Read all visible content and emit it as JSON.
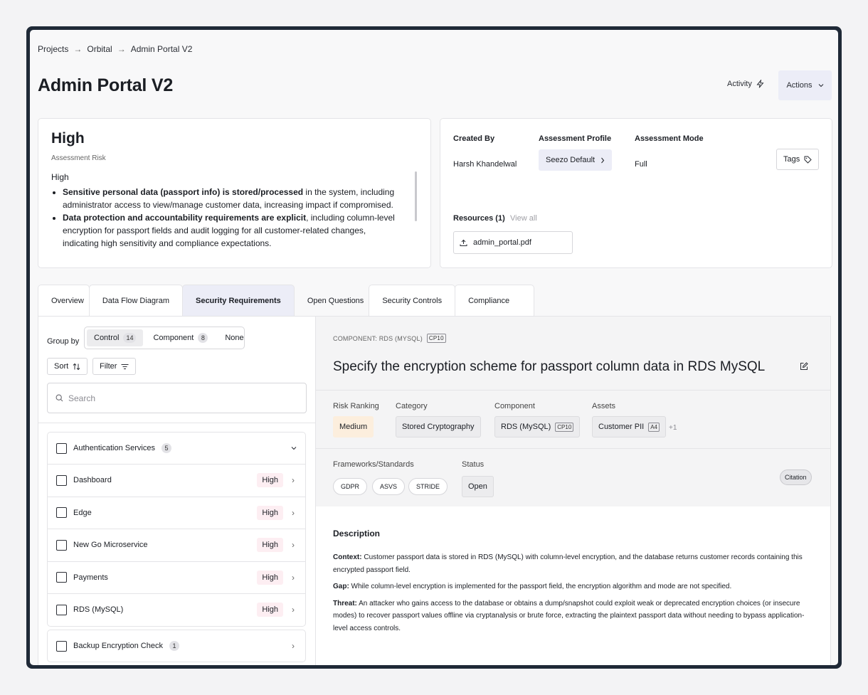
{
  "breadcrumb": [
    "Projects",
    "Orbital",
    "Admin Portal V2"
  ],
  "page_title": "Admin Portal V2",
  "header": {
    "activity": "Activity",
    "actions": "Actions"
  },
  "risk": {
    "level": "High",
    "label": "Assessment Risk",
    "text_head": "High",
    "bullets": [
      {
        "bold": "Sensitive personal data (passport info) is stored/processed",
        "rest": " in the system, including administrator access to view/manage customer data, increasing impact if compromised."
      },
      {
        "bold": "Data protection and accountability requirements are explicit",
        "rest": ", including column-level encryption for passport fields and audit logging for all customer-related changes, indicating high sensitivity and compliance expectations."
      }
    ]
  },
  "meta": {
    "created_by_label": "Created By",
    "created_by": "Harsh Khandelwal",
    "profile_label": "Assessment Profile",
    "profile": "Seezo Default",
    "mode_label": "Assessment Mode",
    "mode": "Full",
    "tags": "Tags",
    "resources_label": "Resources (1)",
    "view_all": "View all",
    "resource_file": "admin_portal.pdf"
  },
  "tabs": [
    "Overview",
    "Data Flow Diagram",
    "Security Requirements",
    "Open Questions",
    "Security Controls",
    "Compliance"
  ],
  "left": {
    "group_by": "Group by",
    "seg": [
      {
        "label": "Control",
        "count": "14"
      },
      {
        "label": "Component",
        "count": "8"
      },
      {
        "label": "None",
        "count": ""
      }
    ],
    "sort": "Sort",
    "filter": "Filter",
    "search_placeholder": "Search",
    "groups": [
      {
        "name": "Authentication Services",
        "count": "5",
        "rows": [
          {
            "name": "Dashboard",
            "badge": "High"
          },
          {
            "name": "Edge",
            "badge": "High"
          },
          {
            "name": "New Go Microservice",
            "badge": "High"
          },
          {
            "name": "Payments",
            "badge": "High"
          },
          {
            "name": "RDS (MySQL)",
            "badge": "High"
          }
        ]
      },
      {
        "name": "Backup Encryption Check",
        "count": "1",
        "rows": []
      }
    ]
  },
  "detail": {
    "component_label": "COMPONENT: RDS (MYSQL)",
    "component_code": "CP10",
    "title": "Specify the encryption scheme for passport column data in RDS MySQL",
    "risk_ranking_label": "Risk Ranking",
    "risk_ranking": "Medium",
    "category_label": "Category",
    "category": "Stored Cryptography",
    "component_field_label": "Component",
    "component": "RDS (MySQL)",
    "component_chip_code": "CP10",
    "assets_label": "Assets",
    "asset": "Customer PII",
    "asset_code": "A4",
    "assets_more": "+1",
    "frameworks_label": "Frameworks/Standards",
    "frameworks": [
      "GDPR",
      "ASVS",
      "STRIDE"
    ],
    "status_label": "Status",
    "status": "Open",
    "citation": "Citation",
    "description_title": "Description",
    "context_label": "Context:",
    "context": " Customer passport data is stored in RDS (MySQL) with column-level encryption, and the database returns customer records containing this encrypted passport field.",
    "gap_label": "Gap:",
    "gap": " While column-level encryption is implemented for the passport field, the encryption algorithm and mode are not specified.",
    "threat_label": "Threat:",
    "threat": " An attacker who gains access to the database or obtains a dump/snapshot could exploit weak or deprecated encryption choices (or insecure modes) to recover passport values offline via cryptanalysis or brute force, extracting the plaintext passport data without needing to bypass application-level access controls."
  }
}
